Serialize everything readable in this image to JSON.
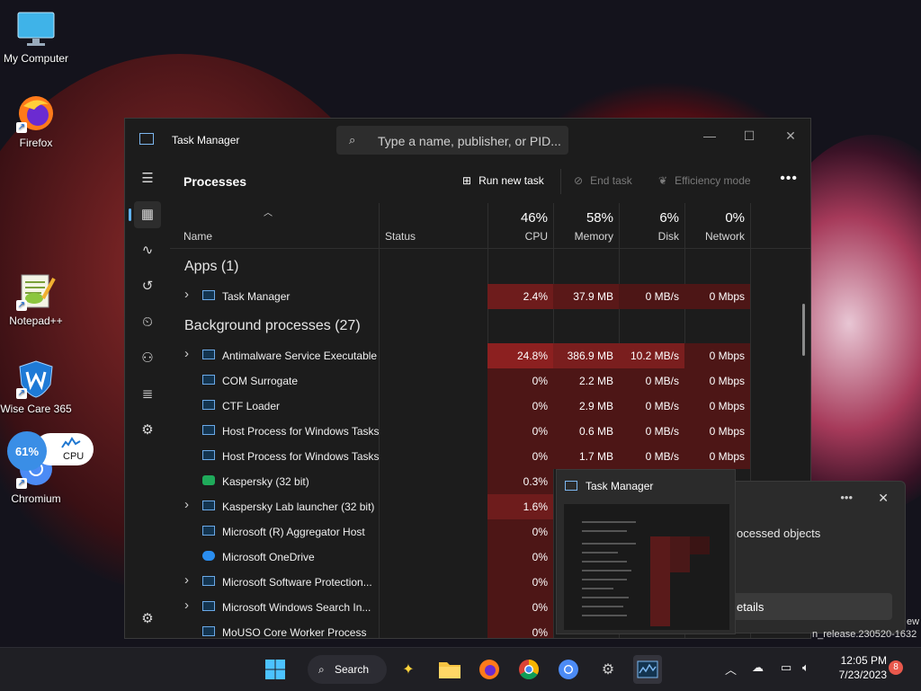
{
  "desktop": {
    "icons": [
      {
        "label": "My Computer"
      },
      {
        "label": "Firefox"
      },
      {
        "label": "Notepad++"
      },
      {
        "label": "Wise Care 365"
      },
      {
        "label": "Chromium"
      }
    ],
    "cpu_widget": {
      "percent": "61%",
      "label": "CPU"
    }
  },
  "taskmanager": {
    "title": "Task Manager",
    "search_placeholder": "Type a name, publisher, or PID...",
    "page_title": "Processes",
    "commands": {
      "run_new_task": "Run new task",
      "end_task": "End task",
      "efficiency_mode": "Efficiency mode"
    },
    "columns": {
      "name": "Name",
      "status": "Status",
      "cpu": {
        "pct": "46%",
        "label": "CPU"
      },
      "memory": {
        "pct": "58%",
        "label": "Memory"
      },
      "disk": {
        "pct": "6%",
        "label": "Disk"
      },
      "network": {
        "pct": "0%",
        "label": "Network"
      }
    },
    "groups": {
      "apps": "Apps (1)",
      "background": "Background processes (27)"
    },
    "apps": [
      {
        "name": "Task Manager",
        "cpu": "2.4%",
        "memory": "37.9 MB",
        "disk": "0 MB/s",
        "network": "0 Mbps"
      }
    ],
    "background": [
      {
        "name": "Antimalware Service Executable",
        "cpu": "24.8%",
        "memory": "386.9 MB",
        "disk": "10.2 MB/s",
        "network": "0 Mbps"
      },
      {
        "name": "COM Surrogate",
        "cpu": "0%",
        "memory": "2.2 MB",
        "disk": "0 MB/s",
        "network": "0 Mbps"
      },
      {
        "name": "CTF Loader",
        "cpu": "0%",
        "memory": "2.9 MB",
        "disk": "0 MB/s",
        "network": "0 Mbps"
      },
      {
        "name": "Host Process for Windows Tasks",
        "cpu": "0%",
        "memory": "0.6 MB",
        "disk": "0 MB/s",
        "network": "0 Mbps"
      },
      {
        "name": "Host Process for Windows Tasks",
        "cpu": "0%",
        "memory": "1.7 MB",
        "disk": "0 MB/s",
        "network": "0 Mbps"
      },
      {
        "name": "Kaspersky (32 bit)",
        "cpu": "0.3%",
        "memory": "",
        "disk": "",
        "network": ""
      },
      {
        "name": "Kaspersky Lab launcher (32 bit)",
        "cpu": "1.6%",
        "memory": "",
        "disk": "",
        "network": ""
      },
      {
        "name": "Microsoft (R) Aggregator Host",
        "cpu": "0%",
        "memory": "",
        "disk": "",
        "network": ""
      },
      {
        "name": "Microsoft OneDrive",
        "cpu": "0%",
        "memory": "",
        "disk": "",
        "network": ""
      },
      {
        "name": "Microsoft Software Protection...",
        "cpu": "0%",
        "memory": "",
        "disk": "",
        "network": ""
      },
      {
        "name": "Microsoft Windows Search In...",
        "cpu": "0%",
        "memory": "",
        "disk": "",
        "network": ""
      },
      {
        "name": "MoUSO Core Worker Process",
        "cpu": "0%",
        "memory": "",
        "disk": "",
        "network": ""
      }
    ]
  },
  "thumbnail": {
    "title": "Task Manager"
  },
  "toast": {
    "text": "ocessed objects",
    "button": "etails"
  },
  "build_tag": "n_release.230520-1632",
  "build_tag_top": "ew",
  "taskbar": {
    "search_label": "Search",
    "time": "12:05 PM",
    "date": "7/23/2023",
    "notifications": "8"
  }
}
